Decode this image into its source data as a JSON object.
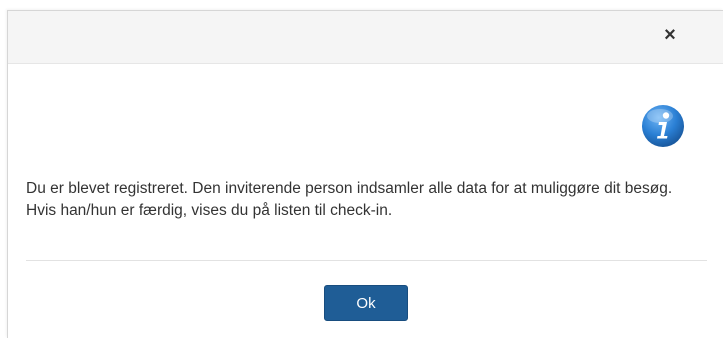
{
  "dialog": {
    "close_label": "×",
    "icon": "info-icon",
    "message": "Du er blevet registreret. Den inviterende person indsamler alle data for at muliggøre dit besøg. Hvis han/hun er færdig, vises du på listen til check-in.",
    "ok_label": "Ok"
  },
  "colors": {
    "header_bg": "#f5f5f5",
    "button_bg": "#1f5d96",
    "icon_blue": "#2a7fd4",
    "text": "#333333"
  }
}
